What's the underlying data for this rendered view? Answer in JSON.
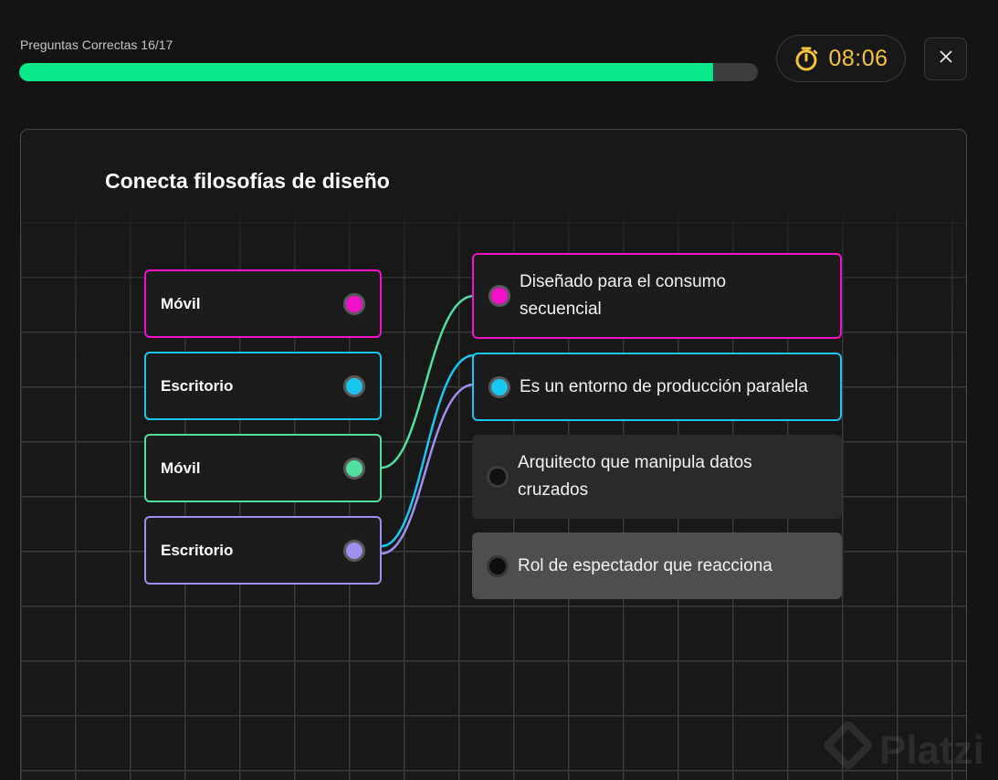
{
  "header": {
    "progress_label": "Preguntas Correctas 16/17",
    "progress_fraction": 0.94,
    "timer": "08:06",
    "close_icon": "close-icon",
    "timer_icon": "stopwatch-icon"
  },
  "colors": {
    "progress": "#0ae98a",
    "timer_text": "#f5c33b",
    "magenta": "#f011c8",
    "cyan": "#18c6ee",
    "green": "#4fe0a0",
    "purple": "#9f8ff0"
  },
  "exercise": {
    "title": "Conecta filosofías de diseño",
    "left_items": [
      {
        "label": "Móvil",
        "color": "#f011c8"
      },
      {
        "label": "Escritorio",
        "color": "#18c6ee"
      },
      {
        "label": "Móvil",
        "color": "#4fe0a0"
      },
      {
        "label": "Escritorio",
        "color": "#9f8ff0"
      }
    ],
    "right_items": [
      {
        "label": "Diseñado para el consumo secuencial",
        "color": "#f011c8"
      },
      {
        "label": "Es un entorno de producción paralela",
        "color": "#18c6ee"
      },
      {
        "label": "Arquitecto que manipula datos cruzados",
        "color": ""
      },
      {
        "label": "Rol de espectador que reacciona",
        "color": ""
      }
    ],
    "connections": [
      {
        "from": 2,
        "to": 0,
        "color": "#4fe0a0"
      },
      {
        "from": 3,
        "to": 1,
        "color": "#18c6ee"
      },
      {
        "from": 3,
        "to": 1,
        "color": "#9f8ff0"
      }
    ]
  },
  "watermark": "Platzi"
}
